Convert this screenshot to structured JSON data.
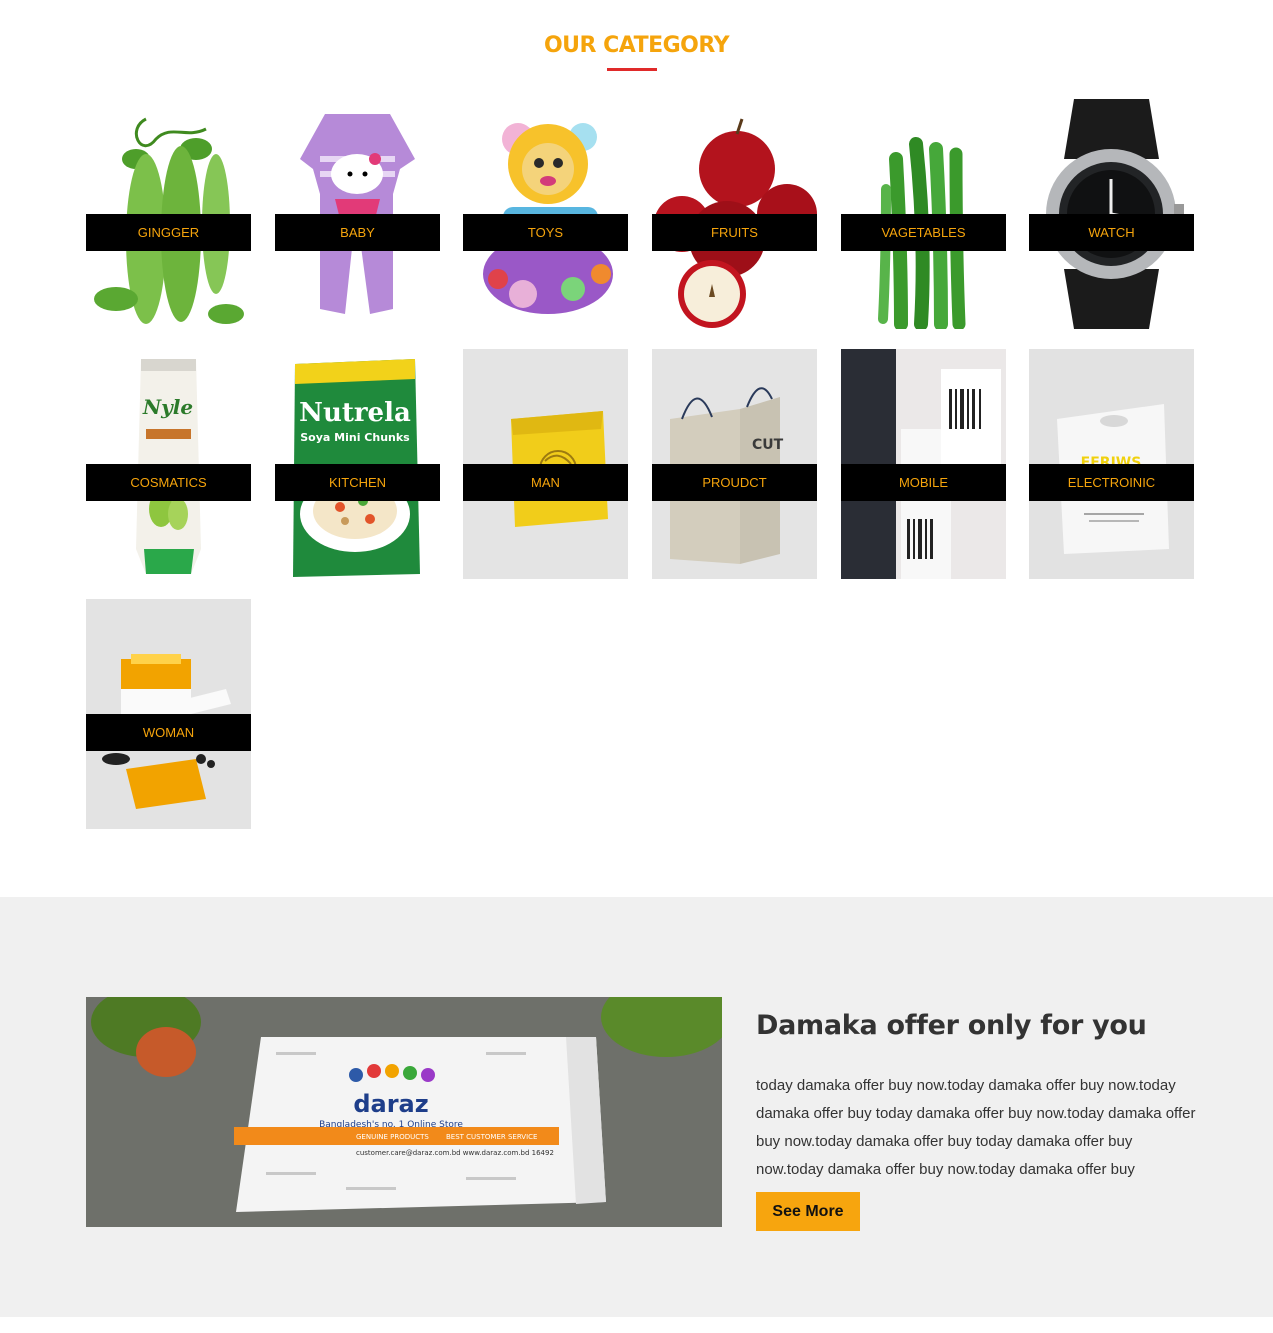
{
  "section": {
    "title": "OUR CATEGORY",
    "accent_color": "#f5a40c",
    "underline_color": "#e02a2a"
  },
  "categories": [
    {
      "label": "GINGGER",
      "image": "bitter-gourd-image"
    },
    {
      "label": "BABY",
      "image": "baby-romper-image"
    },
    {
      "label": "TOYS",
      "image": "lion-toy-image"
    },
    {
      "label": "FRUITS",
      "image": "apples-image"
    },
    {
      "label": "VAGETABLES",
      "image": "okra-image"
    },
    {
      "label": "WATCH",
      "image": "wristwatch-image"
    },
    {
      "label": "COSMATICS",
      "image": "conditioner-tube-image"
    },
    {
      "label": "KITCHEN",
      "image": "soya-chunks-pack-image"
    },
    {
      "label": "MAN",
      "image": "yellow-mailer-image"
    },
    {
      "label": "PROUDCT",
      "image": "paper-bags-image"
    },
    {
      "label": "MOBILE",
      "image": "barcode-labels-image"
    },
    {
      "label": "ELECTROINIC",
      "image": "shopping-bag-image"
    },
    {
      "label": "WOMAN",
      "image": "cosmetic-box-image"
    }
  ],
  "offer": {
    "title": "Damaka offer only for you",
    "text": "today damaka offer buy now.today damaka offer buy now.today damaka offer buy today damaka offer buy now.today damaka offer buy now.today damaka offer buy today damaka offer buy now.today damaka offer buy now.today damaka offer buy",
    "button_label": "See More",
    "button_color": "#f7a50e",
    "image": {
      "brand": "daraz",
      "tagline": "Bangladesh's no. 1 Online Store",
      "bar_text_1": "GENUINE PRODUCTS",
      "bar_text_2": "BEST CUSTOMER SERVICE",
      "footer_text": "customer.care@daraz.com.bd  www.daraz.com.bd  16492"
    }
  }
}
